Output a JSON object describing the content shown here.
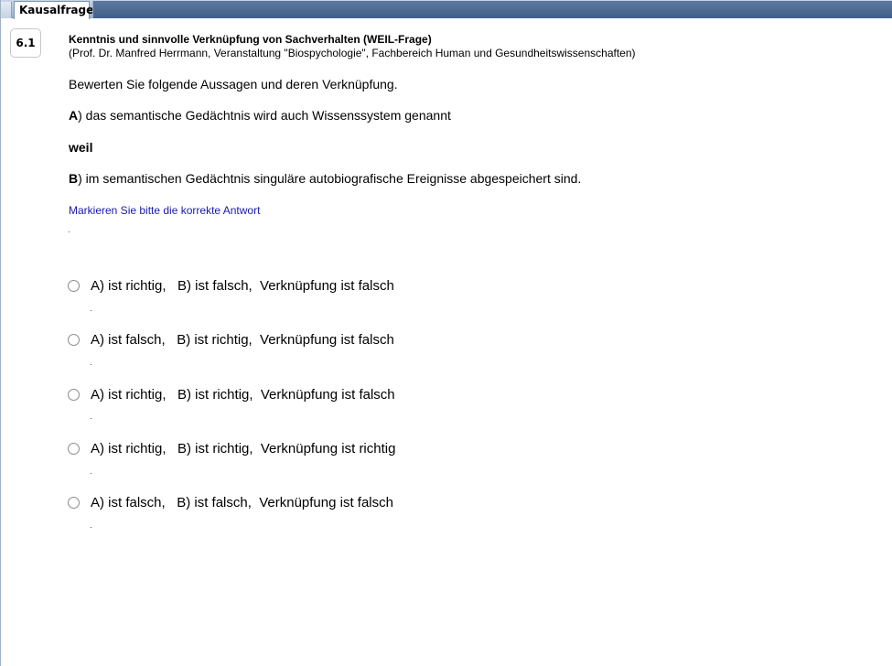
{
  "tab": {
    "label": "Kausalfrage"
  },
  "question": {
    "number": "6.1",
    "title": "Kenntnis und sinnvolle Verknüpfung von Sachverhalten (WEIL-Frage)",
    "source": "(Prof. Dr. Manfred Herrmann, Veranstaltung \"Biospychologie\", Fachbereich Human und Gesundheitswissenschaften)",
    "instruction": "Bewerten Sie folgende Aussagen und deren Verknüpfung.",
    "statement_a_prefix": "A",
    "statement_a_text": ") das semantische Gedächtnis wird auch Wissenssystem genannt",
    "connector": "weil",
    "statement_b_prefix": "B",
    "statement_b_text": ") im semantischen Gedächtnis singuläre autobiografische Ereignisse abgespeichert sind.",
    "hint": "Markieren Sie bitte die korrekte Antwort"
  },
  "options": [
    {
      "label": "A) ist richtig,   B) ist falsch,  Verknüpfung ist falsch"
    },
    {
      "label": "A) ist falsch,   B) ist richtig,  Verknüpfung ist falsch"
    },
    {
      "label": "A) ist richtig,   B) ist richtig,  Verknüpfung ist falsch"
    },
    {
      "label": "A) ist richtig,   B) ist richtig,  Verknüpfung ist richtig"
    },
    {
      "label": "A) ist falsch,   B) ist falsch,  Verknüpfung ist falsch"
    }
  ],
  "colors": {
    "hint_text": "#1a1aa8",
    "tab_bar": "#4a6890"
  }
}
